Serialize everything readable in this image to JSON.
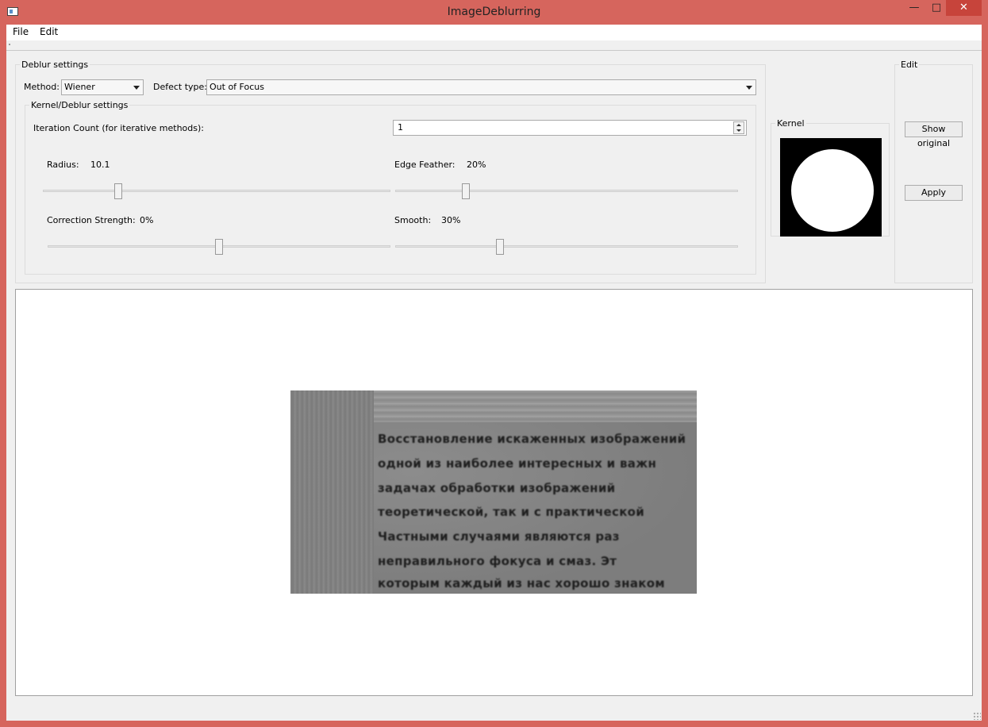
{
  "window": {
    "title": "ImageDeblurring",
    "minimize_glyph": "—",
    "maximize_glyph": "□",
    "close_glyph": "✕"
  },
  "menu": {
    "items": [
      "File",
      "Edit"
    ]
  },
  "deblur_settings": {
    "title": "Deblur settings",
    "method_label": "Method:",
    "method_value": "Wiener",
    "defect_label": "Defect type:",
    "defect_value": "Out of Focus"
  },
  "kernel_settings": {
    "title": "Kernel/Deblur settings",
    "iteration_label": "Iteration Count (for iterative methods):",
    "iteration_value": "1",
    "radius_label": "Radius:",
    "radius_value": "10.1",
    "radius_level": 0.21,
    "edge_label": "Edge Feather:",
    "edge_value": "20%",
    "edge_level": 0.2,
    "strength_label": "Correction Strength:",
    "strength_value": "0%",
    "strength_level": 0.5,
    "smooth_label": "Smooth:",
    "smooth_value": "30%",
    "smooth_level": 0.3
  },
  "kernel": {
    "title": "Kernel"
  },
  "edit": {
    "title": "Edit",
    "show_original_label": "Show original",
    "apply_label": "Apply"
  },
  "document": {
    "lines": [
      "Восстановление искаженных изображений",
      "одной из наиболее интересных и важн",
      "задачах   обработки   изображений",
      "теоретической,  так  и  с  практической",
      "Частными   случаями   являются   раз",
      "неправильного  фокуса  и  смаз.  Эт",
      "которым каждый из нас хорошо знаком"
    ]
  },
  "colors": {
    "titlebar": "#d6655d",
    "close_button": "#c7443b",
    "window_bg": "#f0f0f0"
  }
}
